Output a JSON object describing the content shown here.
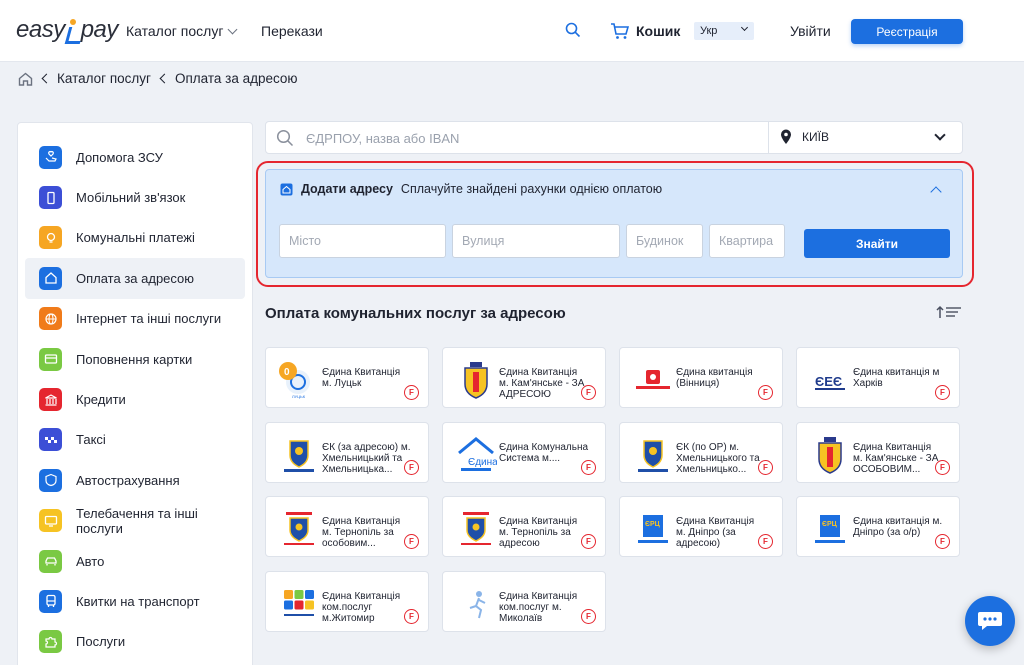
{
  "header": {
    "logo": "easypay",
    "catalog": "Каталог послуг",
    "transfers": "Перекази",
    "cart": "Кошик",
    "lang": "Укр",
    "logout": "Увійти",
    "register": "Реєстрація"
  },
  "breadcrumb": [
    "Каталог послуг",
    "Оплата за адресою"
  ],
  "sidebar": {
    "items": [
      {
        "label": "Допомога ЗСУ",
        "icon": "hands-heart-icon",
        "color": "#1c6fe0"
      },
      {
        "label": "Мобільний зв'язок",
        "icon": "phone-icon",
        "color": "#3c4fd6"
      },
      {
        "label": "Комунальні платежі",
        "icon": "bulb-icon",
        "color": "#f6a623"
      },
      {
        "label": "Оплата за адресою",
        "icon": "house-icon",
        "color": "#1c6fe0"
      },
      {
        "label": "Інтернет та інші послуги",
        "icon": "globe-icon",
        "color": "#f07b1a"
      },
      {
        "label": "Поповнення картки",
        "icon": "card-icon",
        "color": "#7ac943"
      },
      {
        "label": "Кредити",
        "icon": "bank-icon",
        "color": "#e5262f"
      },
      {
        "label": "Таксі",
        "icon": "taxi-icon",
        "color": "#3c4fd6"
      },
      {
        "label": "Автострахування",
        "icon": "shield-car-icon",
        "color": "#1c6fe0"
      },
      {
        "label": "Телебачення та інші послуги",
        "icon": "tv-icon",
        "color": "#f6c323"
      },
      {
        "label": "Авто",
        "icon": "car-icon",
        "color": "#7ac943"
      },
      {
        "label": "Квитки на транспорт",
        "icon": "bus-icon",
        "color": "#1c6fe0"
      },
      {
        "label": "Послуги",
        "icon": "puzzle-icon",
        "color": "#7ac943"
      }
    ]
  },
  "search": {
    "placeholder": "ЄДРПОУ, назва або IBAN",
    "city": "КИЇВ"
  },
  "address": {
    "title": "Додати адресу",
    "subtitle": "Сплачуйте знайдені рахунки однією оплатою",
    "city_placeholder": "Місто",
    "street_placeholder": "Вулиця",
    "house_placeholder": "Будинок",
    "apt_placeholder": "Квартира",
    "find": "Знайти"
  },
  "section": {
    "title": "Оплата комунальних послуг за адресою"
  },
  "cards": [
    {
      "text": "Єдина Квитанція м. Луцьк",
      "logo": "lutsk-logo-icon"
    },
    {
      "text": "Єдина Квитанція м. Кам'янське - ЗА АДРЕСОЮ",
      "logo": "kamianske-crest-icon"
    },
    {
      "text": "Єдина квитанція (Вінниця)",
      "logo": "vinnytsia-logo-icon"
    },
    {
      "text": "Єдина квитанція м Харків",
      "logo": "kharkiv-logo-icon"
    },
    {
      "text": "ЄК (за адресою) м. Хмельницький та Хмельницька...",
      "logo": "khmelnytskyi-crest-icon"
    },
    {
      "text": "Єдина Комунальна Система м....",
      "logo": "kremenchuk-house-icon"
    },
    {
      "text": "ЄК (по ОР) м. Хмельницького та Хмельницько...",
      "logo": "khmelnytskyi-crest-icon"
    },
    {
      "text": "Єдина Квитанція м. Кам'янське - ЗА ОСОБОВИМ...",
      "logo": "kamianske-crest-icon"
    },
    {
      "text": "Єдина Квитанція м. Тернопіль за особовим...",
      "logo": "ternopil-crest-icon"
    },
    {
      "text": "Єдина Квитанція м. Тернопіль за адресою",
      "logo": "ternopil-crest-icon"
    },
    {
      "text": "Єдина Квитанція м. Дніпро (за адресою)",
      "logo": "dnipro-logo-icon"
    },
    {
      "text": "Єдина квитанція м. Дніпро (за о/р)",
      "logo": "dnipro-logo-icon"
    },
    {
      "text": "Єдина Квитанція ком.послуг м.Житомир",
      "logo": "zhytomyr-logo-icon"
    },
    {
      "text": "Єдина Квитанція ком.послуг м. Миколаїв",
      "logo": "mykolaiv-logo-icon"
    }
  ],
  "badge": "F"
}
